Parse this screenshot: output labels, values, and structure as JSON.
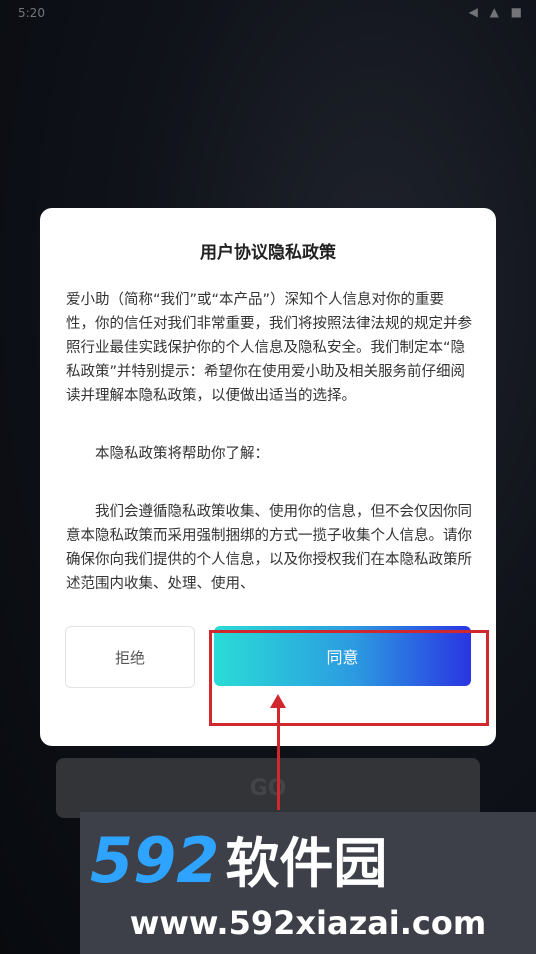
{
  "status_bar": {
    "time": "5:20",
    "icons": "◀ ▲ ■"
  },
  "background": {
    "go_label": "GO"
  },
  "dialog": {
    "title": "用户协议隐私政策",
    "paragraphs": [
      "爱小助（简称“我们”或“本产品”）深知个人信息对你的重要性，你的信任对我们非常重要，我们将按照法律法规的规定并参照行业最佳实践保护你的个人信息及隐私安全。我们制定本“隐私政策”并特别提示：希望你在使用爱小助及相关服务前仔细阅读并理解本隐私政策，以便做出适当的选择。",
      "本隐私政策将帮助你了解：",
      "我们会遵循隐私政策收集、使用你的信息，但不会仅因你同意本隐私政策而采用强制捆绑的方式一揽子收集个人信息。请你确保你向我们提供的个人信息，以及你授权我们在本隐私政策所述范围内收集、处理、使用、"
    ],
    "reject_label": "拒绝",
    "agree_label": "同意"
  },
  "watermark": {
    "logo_number": "592",
    "logo_text": "软件园",
    "url": "www.592xiazai.com"
  },
  "colors": {
    "highlight": "#d0282c",
    "agree_start": "#29dcd6",
    "agree_end": "#2a35e2"
  }
}
